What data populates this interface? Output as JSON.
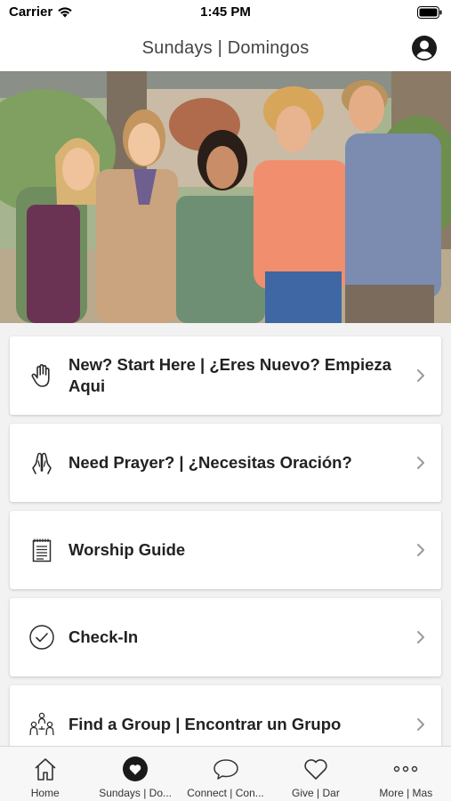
{
  "status_bar": {
    "carrier": "Carrier",
    "time": "1:45 PM"
  },
  "nav": {
    "title": "Sundays | Domingos"
  },
  "hero": {
    "icon": "group-photo"
  },
  "cards": [
    {
      "label": "New? Start Here | ¿Eres Nuevo? Empieza Aqui",
      "icon": "hand-icon"
    },
    {
      "label": "Need Prayer? | ¿Necesitas Oración?",
      "icon": "praying-hands-icon"
    },
    {
      "label": "Worship Guide",
      "icon": "notepad-icon"
    },
    {
      "label": "Check-In",
      "icon": "checkmark-circle-icon"
    },
    {
      "label": "Find a Group | Encontrar un Grupo",
      "icon": "people-group-icon"
    }
  ],
  "tabs": [
    {
      "label": "Home",
      "icon": "home-icon",
      "active": false
    },
    {
      "label": "Sundays | Do...",
      "icon": "heart-filled-icon",
      "active": true
    },
    {
      "label": "Connect | Con...",
      "icon": "chat-bubble-icon",
      "active": false
    },
    {
      "label": "Give | Dar",
      "icon": "heart-outline-icon",
      "active": false
    },
    {
      "label": "More | Mas",
      "icon": "more-dots-icon",
      "active": false
    }
  ],
  "colors": {
    "background": "#f2f2f2",
    "card": "#ffffff",
    "text": "#222222",
    "chevron": "#9a9a9a"
  }
}
